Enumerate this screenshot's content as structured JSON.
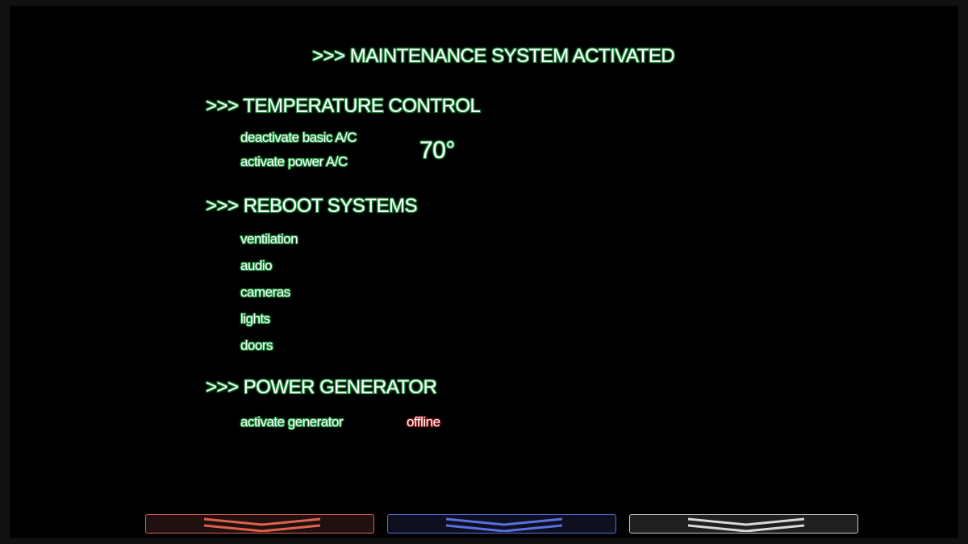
{
  "title": ">>> MAINTENANCE SYSTEM ACTIVATED",
  "sections": {
    "temperature": {
      "heading": ">>> TEMPERATURE CONTROL",
      "items": [
        "deactivate basic A/C",
        "activate power A/C"
      ],
      "temperature_readout": "70°"
    },
    "reboot": {
      "heading": ">>> REBOOT SYSTEMS",
      "items": [
        "ventilation",
        "audio",
        "cameras",
        "lights",
        "doors"
      ]
    },
    "generator": {
      "heading": ">>> POWER GENERATOR",
      "items": [
        "activate generator"
      ],
      "status": "offline"
    }
  },
  "bottom_buttons": [
    {
      "name": "red",
      "icon": "chevron-down-icon",
      "color": "#e0604c"
    },
    {
      "name": "blue",
      "icon": "chevron-down-icon",
      "color": "#5a6fe0"
    },
    {
      "name": "white",
      "icon": "chevron-down-icon",
      "color": "#d8d8d8"
    }
  ],
  "colors": {
    "glow_green": "#1f8a3c",
    "glow_red": "#8a1414",
    "text": "#ffffff",
    "background": "#000000"
  }
}
